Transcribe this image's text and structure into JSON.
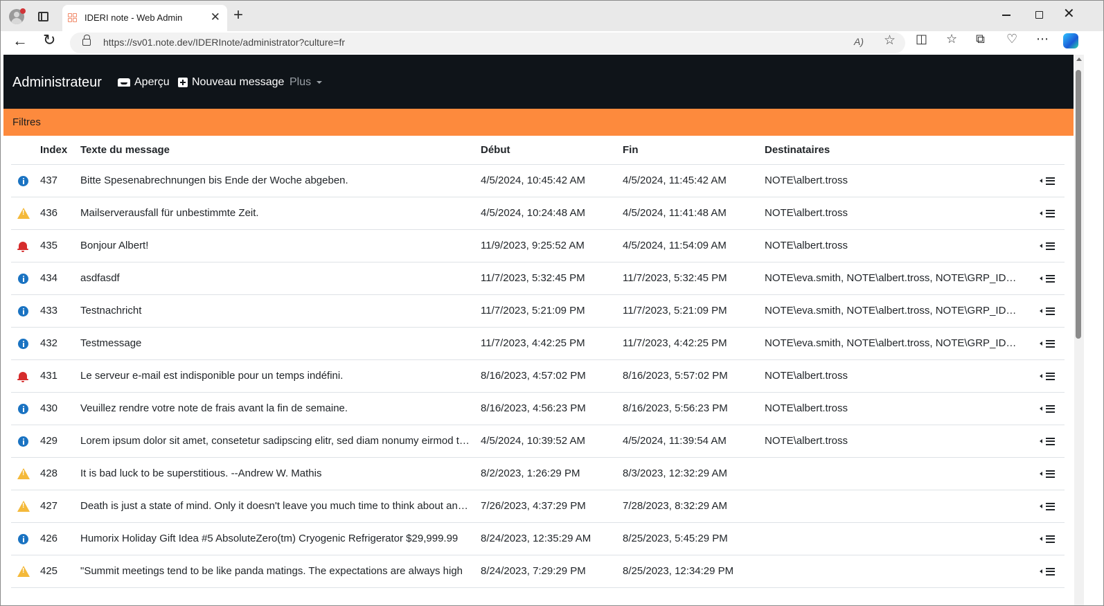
{
  "browser": {
    "tab_title": "IDERI note - Web Admin",
    "tab_close": "✕",
    "new_tab": "+",
    "url": "https://sv01.note.dev/IDERInote/administrator?culture=fr",
    "read_aloud": "A)",
    "favorite": "☆",
    "window_close": "✕",
    "back": "←",
    "refresh": "↻"
  },
  "navbar": {
    "brand": "Administrateur",
    "preview": "Aperçu",
    "new_message": "Nouveau message",
    "more": "Plus"
  },
  "filters": {
    "label": "Filtres"
  },
  "table": {
    "headers": {
      "index": "Index",
      "text": "Texte du message",
      "start": "Début",
      "end": "Fin",
      "recipients": "Destinataires"
    },
    "rows": [
      {
        "icon": "info",
        "index": "437",
        "text": "Bitte Spesenabrechnungen bis Ende der Woche abgeben.",
        "start": "4/5/2024, 10:45:42 AM",
        "end": "4/5/2024, 11:45:42 AM",
        "recipients": "NOTE\\albert.tross"
      },
      {
        "icon": "warning",
        "index": "436",
        "text": "Mailserverausfall für unbestimmte Zeit.",
        "start": "4/5/2024, 10:24:48 AM",
        "end": "4/5/2024, 11:41:48 AM",
        "recipients": "NOTE\\albert.tross"
      },
      {
        "icon": "alert",
        "index": "435",
        "text": "Bonjour Albert!",
        "start": "11/9/2023, 9:25:52 AM",
        "end": "4/5/2024, 11:54:09 AM",
        "recipients": "NOTE\\albert.tross"
      },
      {
        "icon": "info",
        "index": "434",
        "text": "asdfasdf",
        "start": "11/7/2023, 5:32:45 PM",
        "end": "11/7/2023, 5:32:45 PM",
        "recipients": "NOTE\\eva.smith, NOTE\\albert.tross, NOTE\\GRP_IDERI_NOTE_USERS"
      },
      {
        "icon": "info",
        "index": "433",
        "text": "Testnachricht",
        "start": "11/7/2023, 5:21:09 PM",
        "end": "11/7/2023, 5:21:09 PM",
        "recipients": "NOTE\\eva.smith, NOTE\\albert.tross, NOTE\\GRP_IDERI_NOTE_USERS"
      },
      {
        "icon": "info",
        "index": "432",
        "text": "Testmessage",
        "start": "11/7/2023, 4:42:25 PM",
        "end": "11/7/2023, 4:42:25 PM",
        "recipients": "NOTE\\eva.smith, NOTE\\albert.tross, NOTE\\GRP_IDERI_NOTE_USERS"
      },
      {
        "icon": "alert",
        "index": "431",
        "text": "Le serveur e-mail est indisponible pour un temps indéfini.",
        "start": "8/16/2023, 4:57:02 PM",
        "end": "8/16/2023, 5:57:02 PM",
        "recipients": "NOTE\\albert.tross"
      },
      {
        "icon": "info",
        "index": "430",
        "text": "Veuillez rendre votre note de frais avant la fin de semaine.",
        "start": "8/16/2023, 4:56:23 PM",
        "end": "8/16/2023, 5:56:23 PM",
        "recipients": "NOTE\\albert.tross"
      },
      {
        "icon": "info",
        "index": "429",
        "text": "Lorem ipsum dolor sit amet, consetetur sadipscing elitr, sed diam nonumy eirmod tempor",
        "start": "4/5/2024, 10:39:52 AM",
        "end": "4/5/2024, 11:39:54 AM",
        "recipients": "NOTE\\albert.tross"
      },
      {
        "icon": "warning",
        "index": "428",
        "text": "It is bad luck to be superstitious. --Andrew W. Mathis",
        "start": "8/2/2023, 1:26:29 PM",
        "end": "8/3/2023, 12:32:29 AM",
        "recipients": ""
      },
      {
        "icon": "warning",
        "index": "427",
        "text": "Death is just a state of mind. Only it doesn't leave you much time to think about anything",
        "start": "7/26/2023, 4:37:29 PM",
        "end": "7/28/2023, 8:32:29 AM",
        "recipients": ""
      },
      {
        "icon": "info",
        "index": "426",
        "text": "Humorix Holiday Gift Idea #5 AbsoluteZero(tm) Cryogenic Refrigerator $29,999.99",
        "start": "8/24/2023, 12:35:29 AM",
        "end": "8/25/2023, 5:45:29 PM",
        "recipients": ""
      },
      {
        "icon": "warning",
        "index": "425",
        "text": "\"Summit meetings tend to be like panda matings. The expectations are always high",
        "start": "8/24/2023, 7:29:29 PM",
        "end": "8/25/2023, 12:34:29 PM",
        "recipients": ""
      }
    ]
  }
}
